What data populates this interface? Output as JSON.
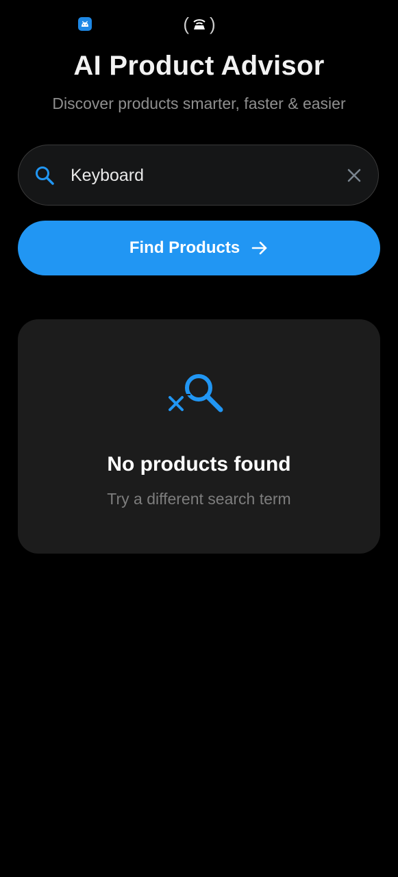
{
  "status_bar": {
    "app_icon": "android-app-icon",
    "hotspot_icon": "hotspot-icon"
  },
  "header": {
    "title": "AI Product Advisor",
    "subtitle": "Discover products smarter, faster & easier"
  },
  "search": {
    "value": "Keyboard",
    "search_icon": "search-icon",
    "clear_icon": "close-icon"
  },
  "find_button": {
    "label": "Find Products",
    "icon": "arrow-right-icon"
  },
  "empty_state": {
    "icon": "search-off-icon",
    "title": "No products found",
    "subtitle": "Try a different search term"
  },
  "colors": {
    "accent": "#2196f3",
    "background": "#000000",
    "card": "#1c1c1c",
    "search_field": "#151617"
  }
}
